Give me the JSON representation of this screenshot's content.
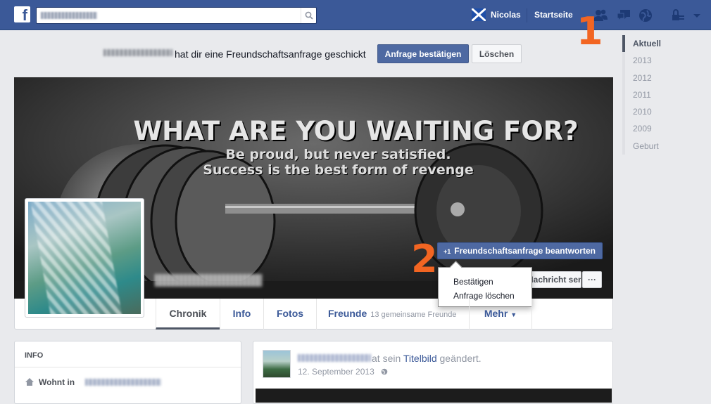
{
  "topbar": {
    "logo": "f",
    "search_value": "",
    "user_name": "Nicolas",
    "home_label": "Startseite",
    "icons": [
      "search-icon",
      "scotland-flag-icon",
      "friend-requests-icon",
      "messages-icon",
      "notifications-icon",
      "privacy-icon",
      "account-menu-icon"
    ]
  },
  "annotations": {
    "one": "1",
    "two": "2"
  },
  "friend_request_bar": {
    "text": "hat dir eine Freundschaftsanfrage geschickt",
    "confirm_label": "Anfrage bestätigen",
    "delete_label": "Löschen"
  },
  "years": [
    "Aktuell",
    "2013",
    "2012",
    "2011",
    "2010",
    "2009",
    "Geburt"
  ],
  "cover": {
    "headline": "WHAT ARE YOU WAITING FOR?",
    "line1": "Be proud, but never satisfied.",
    "line2": "Success is the best form of revenge"
  },
  "actions": {
    "respond_plus": "+1",
    "respond_label": "Freundschaftsanfrage beantworten",
    "message_label": "Nachricht senden",
    "more_dots": "···"
  },
  "dropdown": {
    "items": [
      "Bestätigen",
      "Anfrage löschen"
    ]
  },
  "tabs": {
    "chronik": "Chronik",
    "info": "Info",
    "fotos": "Fotos",
    "freunde": "Freunde",
    "freunde_count": "13 gemeinsame Freunde",
    "mehr": "Mehr"
  },
  "info_card": {
    "title": "INFO",
    "lives_in": "Wohnt in"
  },
  "post": {
    "action_text": "at sein",
    "link_text": "Titelbild",
    "suffix": "geändert.",
    "date": "12. September 2013"
  },
  "colors": {
    "brand": "#3b5998",
    "button": "#4e69a2",
    "annotation": "#f26522"
  }
}
